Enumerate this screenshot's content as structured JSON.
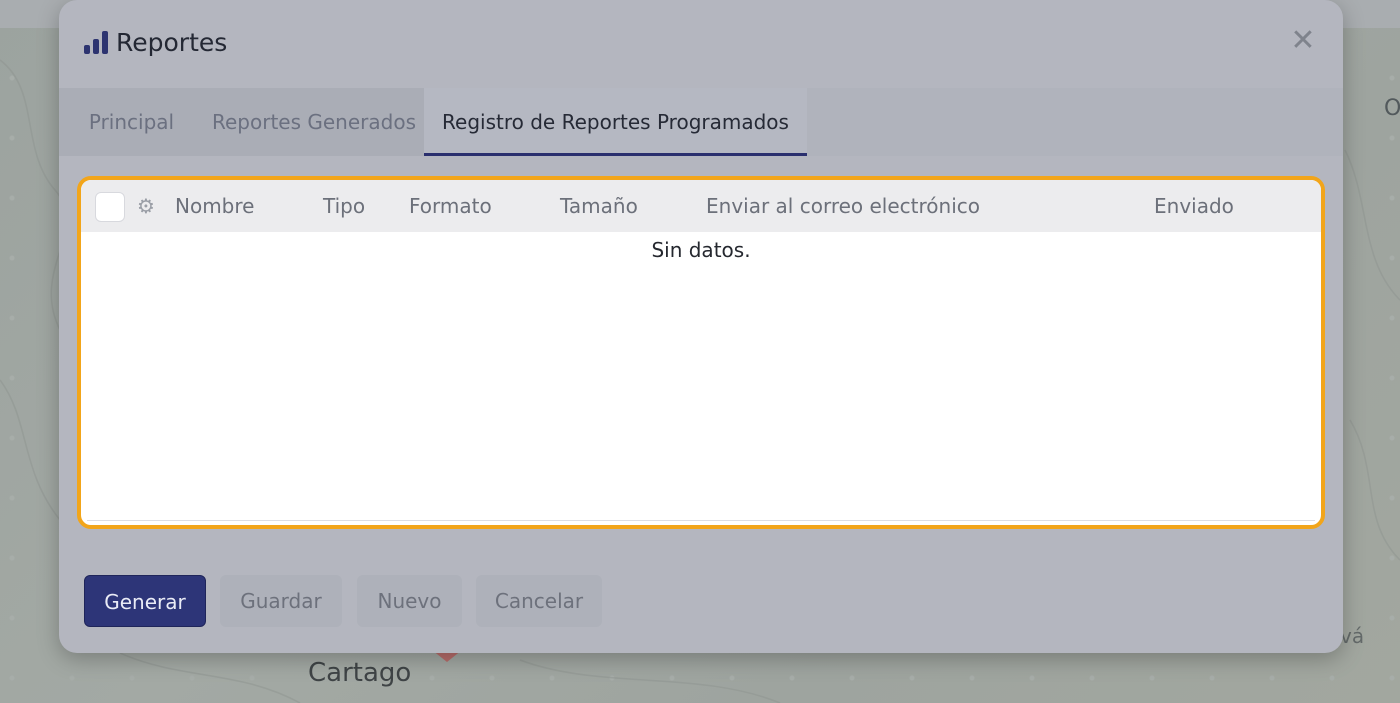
{
  "map": {
    "city_label": "Cartago",
    "edge_label_right": "O",
    "edge_label_bottom_right": "vá"
  },
  "modal": {
    "title": "Reportes",
    "icon": "bar-chart-icon",
    "close_icon": "close-icon",
    "close_glyph": "✕"
  },
  "tabs": [
    {
      "label": "Principal",
      "active": false
    },
    {
      "label": "Reportes Generados",
      "active": false
    },
    {
      "label": "Registro de Reportes Programados",
      "active": true
    }
  ],
  "grid": {
    "columns": [
      "Nombre",
      "Tipo",
      "Formato",
      "Tamaño",
      "Enviar al correo electrónico",
      "Enviado"
    ],
    "empty_text": "Sin datos.",
    "settings_icon": "gears-icon",
    "settings_glyph": "⚙"
  },
  "footer": {
    "generate_label": "Generar",
    "save_label": "Guardar",
    "new_label": "Nuevo",
    "cancel_label": "Cancelar"
  },
  "colors": {
    "accent": "#2d3578",
    "highlight_border": "#f2a51a"
  }
}
